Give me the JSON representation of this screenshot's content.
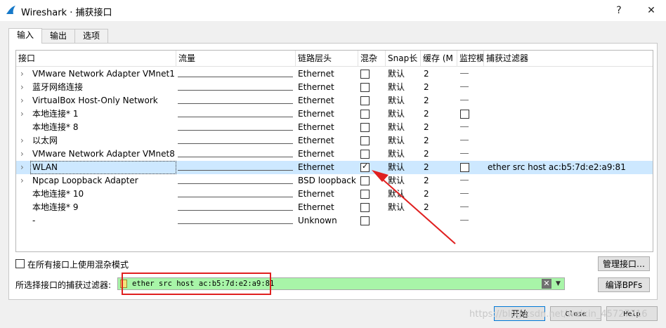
{
  "window": {
    "title": "Wireshark · 捕获接口",
    "help_glyph": "?",
    "close_glyph": "✕"
  },
  "tabs": [
    "输入",
    "输出",
    "选项"
  ],
  "table": {
    "headers": [
      "接口",
      "流量",
      "链路层头",
      "混杂",
      "Snap长",
      "缓存 (M",
      "监控模",
      "捕获过滤器"
    ],
    "rows": [
      {
        "name": "VMware Network Adapter VMnet1",
        "link": "Ethernet",
        "promisc": false,
        "snap": "默认",
        "buffer": "2",
        "monitor": "dash",
        "filter": "",
        "chevron": true
      },
      {
        "name": "蓝牙网络连接",
        "link": "Ethernet",
        "promisc": false,
        "snap": "默认",
        "buffer": "2",
        "monitor": "dash",
        "filter": "",
        "chevron": true
      },
      {
        "name": "VirtualBox Host-Only Network",
        "link": "Ethernet",
        "promisc": false,
        "snap": "默认",
        "buffer": "2",
        "monitor": "dash",
        "filter": "",
        "chevron": true
      },
      {
        "name": "本地连接* 1",
        "link": "Ethernet",
        "promisc": false,
        "snap": "默认",
        "buffer": "2",
        "monitor": "checkbox",
        "filter": "",
        "chevron": true
      },
      {
        "name": "本地连接* 8",
        "link": "Ethernet",
        "promisc": false,
        "snap": "默认",
        "buffer": "2",
        "monitor": "dash",
        "filter": "",
        "chevron": false
      },
      {
        "name": "以太网",
        "link": "Ethernet",
        "promisc": false,
        "snap": "默认",
        "buffer": "2",
        "monitor": "dash",
        "filter": "",
        "chevron": true
      },
      {
        "name": "VMware Network Adapter VMnet8",
        "link": "Ethernet",
        "promisc": false,
        "snap": "默认",
        "buffer": "2",
        "monitor": "dash",
        "filter": "",
        "chevron": true
      },
      {
        "name": "WLAN",
        "link": "Ethernet",
        "promisc": true,
        "snap": "默认",
        "buffer": "2",
        "monitor": "checkbox",
        "filter": "ether src host ac:b5:7d:e2:a9:81",
        "chevron": true,
        "selected": true
      },
      {
        "name": "Npcap Loopback Adapter",
        "link": "BSD loopback",
        "promisc": false,
        "snap": "默认",
        "buffer": "2",
        "monitor": "dash",
        "filter": "",
        "chevron": true
      },
      {
        "name": "本地连接* 10",
        "link": "Ethernet",
        "promisc": false,
        "snap": "默认",
        "buffer": "2",
        "monitor": "dash",
        "filter": "",
        "chevron": false
      },
      {
        "name": "本地连接* 9",
        "link": "Ethernet",
        "promisc": false,
        "snap": "默认",
        "buffer": "2",
        "monitor": "dash",
        "filter": "",
        "chevron": false
      },
      {
        "name": "-",
        "link": "Unknown",
        "promisc": false,
        "snap": "",
        "buffer": "",
        "monitor": "dash",
        "filter": "",
        "chevron": false
      }
    ]
  },
  "promisc_all_label": "在所有接口上使用混杂模式",
  "manage_button": "管理接口…",
  "filter_label": "所选择接口的捕获过滤器:",
  "filter_value": "ether src host ac:b5:7d:e2:a9:81",
  "compile_button": "编译BPFs",
  "start_button": "开始",
  "close_button": "Close",
  "help_button": "Help",
  "watermark": "https://blog.csdn.net/weixin_45727716",
  "colors": {
    "selected_row": "#cde8ff",
    "filter_valid": "#a8f5a8",
    "annotation_red": "#e02020"
  }
}
